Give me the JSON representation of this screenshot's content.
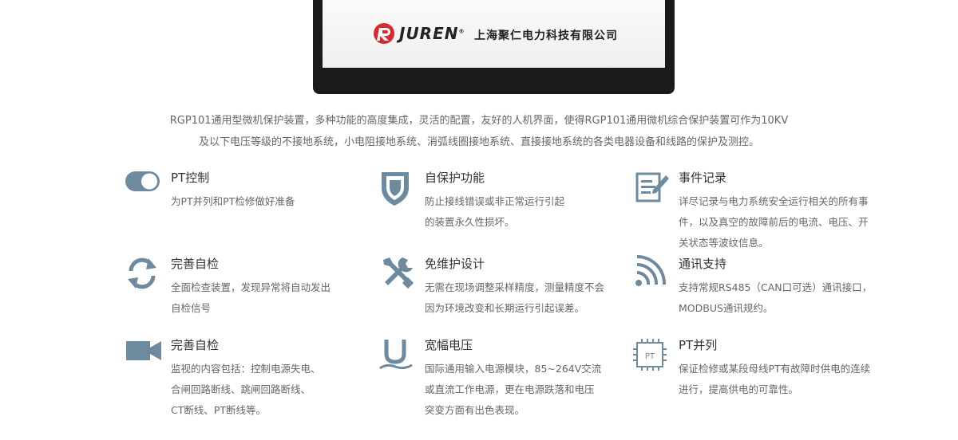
{
  "device": {
    "brand": "JUREN",
    "brand_mark": "®",
    "company": "上海聚仁电力科技有限公司"
  },
  "intro": {
    "line1": "RGP101通用型微机保护装置，多种功能的高度集成，灵活的配置，友好的人机界面，使得RGP101通用微机综合保护装置可作为10KV",
    "line2": "及以下电压等级的不接地系统，小电阻接地系统、消弧线圈接地系统、直接接地系统的各类电器设备和线路的保护及测控。"
  },
  "features": [
    {
      "title": "PT控制",
      "icon": "toggle-switch-icon",
      "desc": [
        "为PT并列和PT检修做好准备"
      ]
    },
    {
      "title": "自保护功能",
      "icon": "shield-icon",
      "desc": [
        "防止接线错误或非正常运行引起",
        "的装置永久性损坏。"
      ]
    },
    {
      "title": "事件记录",
      "icon": "document-edit-icon",
      "desc": [
        "详尽记录与电力系统安全运行相关的所有事",
        "件，以及真空的故障前后的电流、电压、开",
        "关状态等波纹信息。"
      ]
    },
    {
      "title": "完善自检",
      "icon": "refresh-icon",
      "desc": [
        "全面检查装置，发现异常将自动发出",
        "自检信号"
      ]
    },
    {
      "title": "免维护设计",
      "icon": "tools-icon",
      "desc": [
        "无需在现场调整采样精度，测量精度不会",
        "因为环境改变和长期运行引起误差。"
      ]
    },
    {
      "title": "通讯支持",
      "icon": "signal-icon",
      "desc": [
        "支持常规RS485（CAN口可选）通讯接口，",
        "MODBUS通讯规约。"
      ]
    },
    {
      "title": "完善自检",
      "icon": "video-camera-icon",
      "desc": [
        "监视的内容包括：控制电源失电、",
        "合闸回路断线、跳闸回路断线、",
        "CT断线、PT断线等。"
      ]
    },
    {
      "title": "宽幅电压",
      "icon": "voltage-u-icon",
      "desc": [
        "国际通用输入电源模块，85~264V交流",
        "或直流工作电源，更在电源跌落和电压",
        "突变方面有出色表现。"
      ]
    },
    {
      "title": "PT并列",
      "icon": "chip-pt-icon",
      "chip_label": "PT",
      "desc": [
        "保证检修或某段母线PT有故障时供电的连续",
        "进行，提高供电的可靠性。"
      ]
    }
  ],
  "colors": {
    "icon": "#6e8a9e",
    "title": "#333333",
    "text": "#666666",
    "logo_red": "#d9282f"
  }
}
